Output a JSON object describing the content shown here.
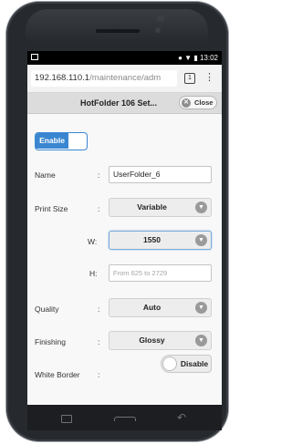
{
  "status_bar": {
    "time": "13:02",
    "icons": [
      "image-icon",
      "record-icon",
      "wifi-icon",
      "battery-icon"
    ]
  },
  "browser": {
    "url_host": "192.168.110.1",
    "url_path": "/maintenance/adm",
    "tab_count": "1"
  },
  "dialog": {
    "title": "HotFolder 106 Set...",
    "close_label": "Close"
  },
  "form": {
    "enable_label": "Enable",
    "name_label": "Name",
    "name_value": "UserFolder_6",
    "print_size_label": "Print Size",
    "print_size_value": "Variable",
    "width_label": "W",
    "width_value": "1550",
    "height_label": "H",
    "height_placeholder": "From 625 to 2729",
    "quality_label": "Quality",
    "quality_value": "Auto",
    "finishing_label": "Finishing",
    "finishing_value": "Glossy",
    "white_border_label": "White Border",
    "white_border_value": "Disable",
    "colon": ":"
  },
  "colors": {
    "accent": "#3a86d0",
    "phone_body": "#26292d"
  }
}
